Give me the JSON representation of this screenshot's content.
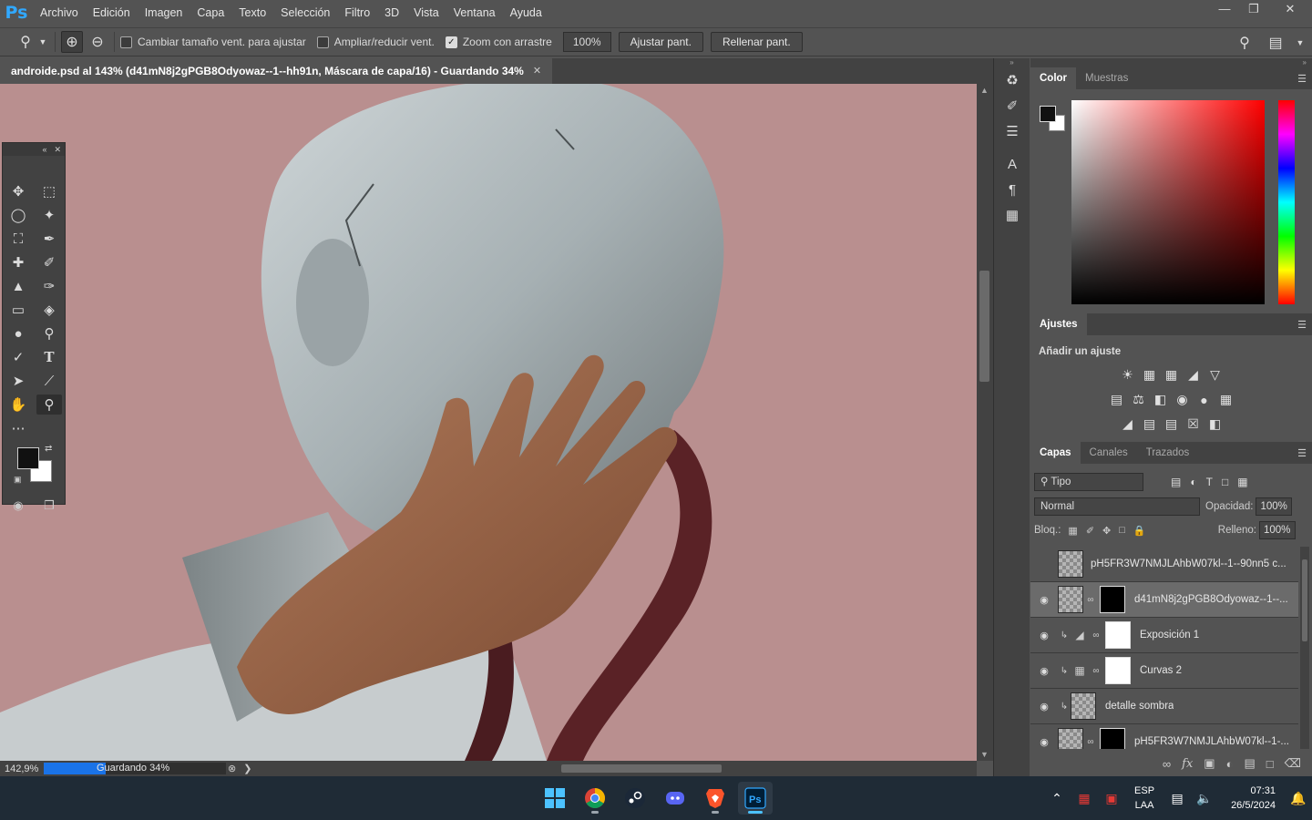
{
  "menubar": {
    "logo": "Ps",
    "items": [
      "Archivo",
      "Edición",
      "Imagen",
      "Capa",
      "Texto",
      "Selección",
      "Filtro",
      "3D",
      "Vista",
      "Ventana",
      "Ayuda"
    ]
  },
  "options": {
    "resize_windows": "Cambiar tamaño vent. para ajustar",
    "zoom_all": "Ampliar/reducir vent.",
    "scrubby_zoom": "Zoom con arrastre",
    "zoom_value": "100%",
    "fit_screen": "Ajustar pant.",
    "fill_screen": "Rellenar pant."
  },
  "document": {
    "tab_title": "androide.psd al 143% (d41mN8j2gPGB8Odyowaz--1--hh91n, Máscara de capa/16) - Guardando 34%"
  },
  "status": {
    "zoom": "142,9%",
    "saving": "Guardando 34%",
    "save_progress": 0.34
  },
  "panels": {
    "color_tabs": [
      "Color",
      "Muestras"
    ],
    "adjustments_tab": "Ajustes",
    "adjustments_title": "Añadir un ajuste",
    "layers_tabs": [
      "Capas",
      "Canales",
      "Trazados"
    ],
    "filter_label": "Tipo",
    "blend_mode": "Normal",
    "opacity_label": "Opacidad:",
    "opacity_value": "100%",
    "lock_label": "Bloq.:",
    "fill_label": "Relleno:",
    "fill_value": "100%"
  },
  "layers": [
    {
      "name": "pH5FR3W7NMJLAhbW07kl--1--90nn5 c...",
      "visible": false,
      "selected": false
    },
    {
      "name": "d41mN8j2gPGB8Odyowaz--1--...",
      "visible": true,
      "selected": true
    },
    {
      "name": "Exposición 1",
      "visible": true,
      "selected": false
    },
    {
      "name": "Curvas 2",
      "visible": true,
      "selected": false
    },
    {
      "name": "detalle sombra",
      "visible": true,
      "selected": false
    },
    {
      "name": "pH5FR3W7NMJLAhbW07kl--1-...",
      "visible": true,
      "selected": false
    }
  ],
  "taskbar": {
    "lang_top": "ESP",
    "lang_bottom": "LAA",
    "time": "07:31",
    "date": "26/5/2024"
  },
  "colors": {
    "canvas_bg": "#b98f8f",
    "accent": "#31a8ff"
  }
}
